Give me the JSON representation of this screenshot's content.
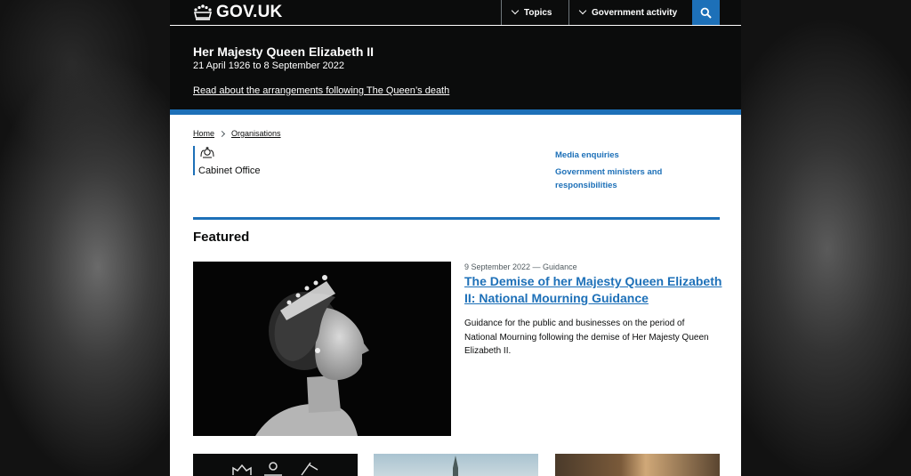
{
  "header": {
    "logo_text": "GOV.UK",
    "nav": [
      {
        "label": "Topics"
      },
      {
        "label": "Government activity"
      }
    ],
    "search_icon": "search-icon"
  },
  "banner": {
    "title": "Her Majesty Queen Elizabeth II",
    "dates": "21 April 1926 to 8 September 2022",
    "link": "Read about the arrangements following The Queen’s death"
  },
  "breadcrumb": {
    "items": [
      "Home",
      "Organisations"
    ]
  },
  "organisation": {
    "name": "Cabinet Office",
    "crest_icon": "royal-crest-icon"
  },
  "side_links": [
    "Media enquiries",
    "Government ministers and responsibilities"
  ],
  "featured": {
    "heading": "Featured",
    "item": {
      "meta": "9 September 2022 — Guidance",
      "title": "The Demise of her Majesty Queen Elizabeth II: National Mourning Guidance",
      "description": "Guidance for the public and businesses on the period of National Mourning following the demise of Her Majesty Queen Elizabeth II."
    }
  },
  "colors": {
    "header_bg": "#0b0c0c",
    "link_blue": "#1d70b8",
    "text": "#0b0c0c",
    "secondary_text": "#505a5f"
  }
}
